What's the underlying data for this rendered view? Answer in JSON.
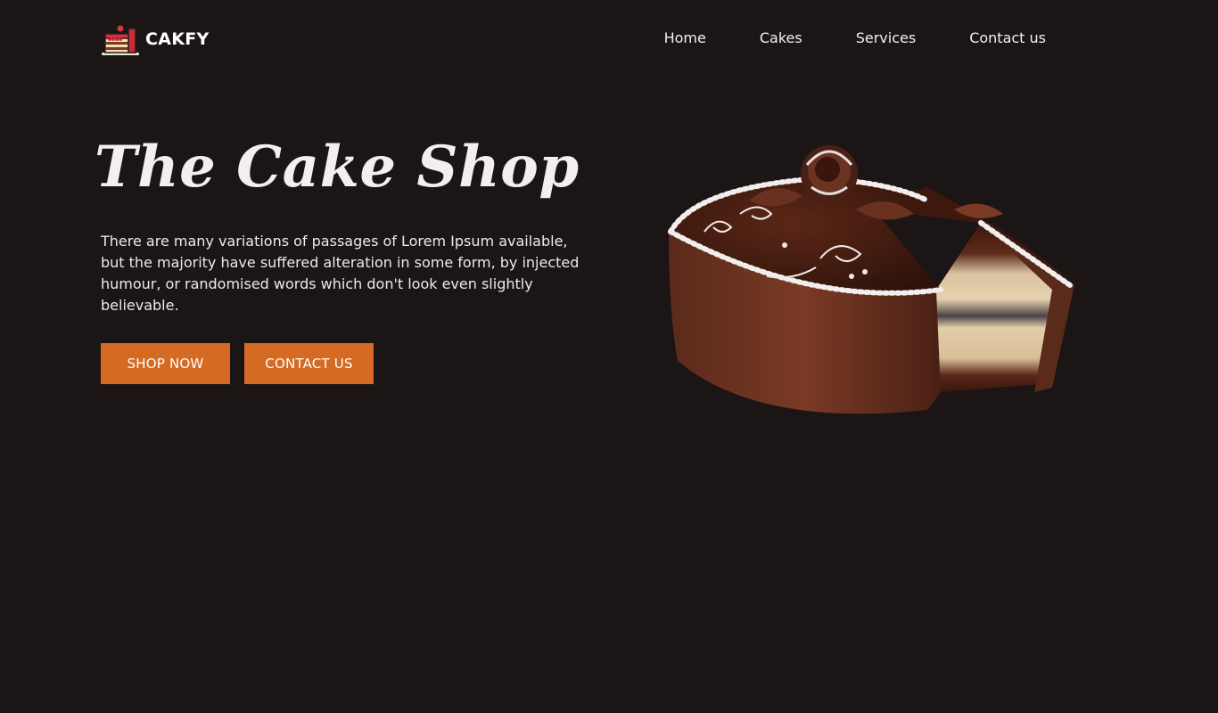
{
  "brand": {
    "name": "CAKFY",
    "logo_icon": "cake-slice-icon"
  },
  "nav": {
    "items": [
      {
        "label": "Home"
      },
      {
        "label": "Cakes"
      },
      {
        "label": "Services"
      },
      {
        "label": "Contact us"
      }
    ]
  },
  "hero": {
    "title": "The Cake Shop",
    "description": "There are many variations of passages of Lorem Ipsum available, but the majority have suffered alteration in some form, by injected humour, or randomised words which don't look even slightly believable.",
    "buttons": {
      "shop_label": "SHOP NOW",
      "contact_label": "CONTACT US"
    },
    "image": "chocolate-cake-image"
  },
  "colors": {
    "background": "#1b1515",
    "accent": "#d56a23",
    "text": "#f2eeee"
  }
}
